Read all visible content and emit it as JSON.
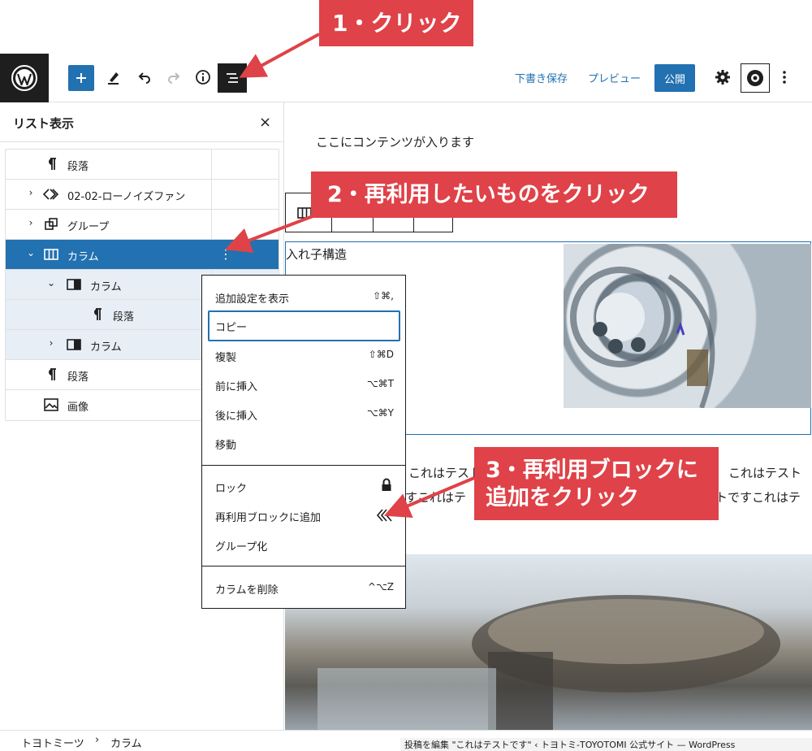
{
  "annotations": {
    "step1": "1・クリック",
    "step2": "2・再利用したいものをクリック",
    "step3_line1": "3・再利用ブロックに",
    "step3_line2": "追加をクリック"
  },
  "toolbar": {
    "save_draft": "下書き保存",
    "preview": "プレビュー",
    "publish": "公開"
  },
  "sidebar": {
    "title": "リスト表示",
    "close": "×",
    "items": [
      {
        "label": "段落"
      },
      {
        "label": "02-02-ローノイズファン"
      },
      {
        "label": "グループ"
      },
      {
        "label": "カラム"
      },
      {
        "label": "カラム"
      },
      {
        "label": "段落"
      },
      {
        "label": "カラム"
      },
      {
        "label": "段落"
      },
      {
        "label": "画像"
      }
    ]
  },
  "content": {
    "paragraph": "ここにコンテンツが入ります",
    "nested_label": "入れ子構造",
    "text_line1_left": "これはテスト",
    "text_line1_right": "これはテスト",
    "text_line2_left": "すこれはテ",
    "text_line2_right": "トですこれはテ"
  },
  "menu": {
    "items": [
      {
        "label": "追加設定を表示",
        "shortcut": "⇧⌘,"
      },
      {
        "label": "コピー",
        "shortcut": ""
      },
      {
        "label": "複製",
        "shortcut": "⇧⌘D"
      },
      {
        "label": "前に挿入",
        "shortcut": "⌥⌘T"
      },
      {
        "label": "後に挿入",
        "shortcut": "⌥⌘Y"
      },
      {
        "label": "移動",
        "shortcut": ""
      },
      {
        "label": "ロック",
        "shortcut": ""
      },
      {
        "label": "再利用ブロックに追加",
        "shortcut": ""
      },
      {
        "label": "グループ化",
        "shortcut": ""
      },
      {
        "label": "カラムを削除",
        "shortcut": "^⌥Z"
      }
    ]
  },
  "breadcrumb": {
    "root": "トヨトミーツ",
    "separator": "›",
    "current": "カラム"
  },
  "tooltip": "投稿を編集 \"これはテストです\" ‹ トヨトミ-TOYOTOMI 公式サイト — WordPress",
  "colors": {
    "accent": "#2271b1",
    "callout": "#df4248",
    "dark": "#1e1e1e"
  }
}
